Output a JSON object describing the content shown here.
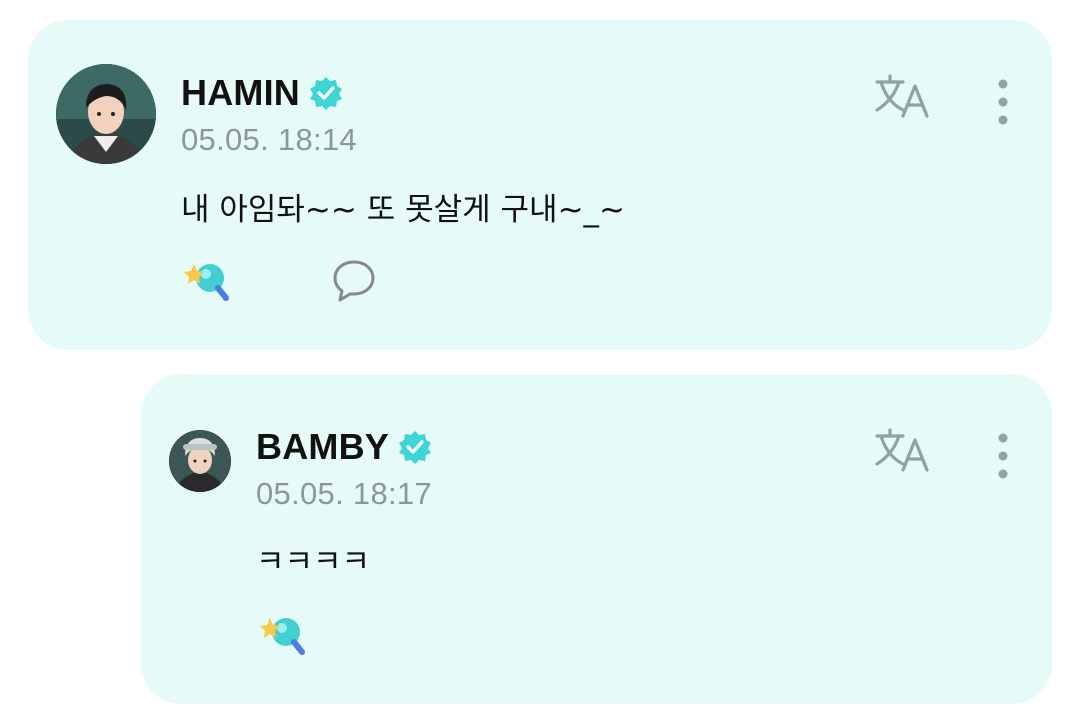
{
  "posts": [
    {
      "author": "HAMIN",
      "timestamp": "05.05. 18:14",
      "message": "내 아임돠~~ 또 못살게 구내~_~",
      "icons": [
        "avatar",
        "verified-badge-icon",
        "translate-icon",
        "more-options-icon",
        "fan-reaction-icon",
        "comment-icon"
      ]
    },
    {
      "author": "BAMBY",
      "timestamp": "05.05. 18:17",
      "message": "ㅋㅋㅋㅋ",
      "icons": [
        "avatar",
        "verified-badge-icon",
        "translate-icon",
        "more-options-icon",
        "fan-reaction-icon"
      ]
    }
  ],
  "colors": {
    "card_background": "#e6fbf7",
    "verified_badge": "#3fd4d6",
    "timestamp": "#8e9797",
    "icon_gray": "#8ea3a3"
  }
}
